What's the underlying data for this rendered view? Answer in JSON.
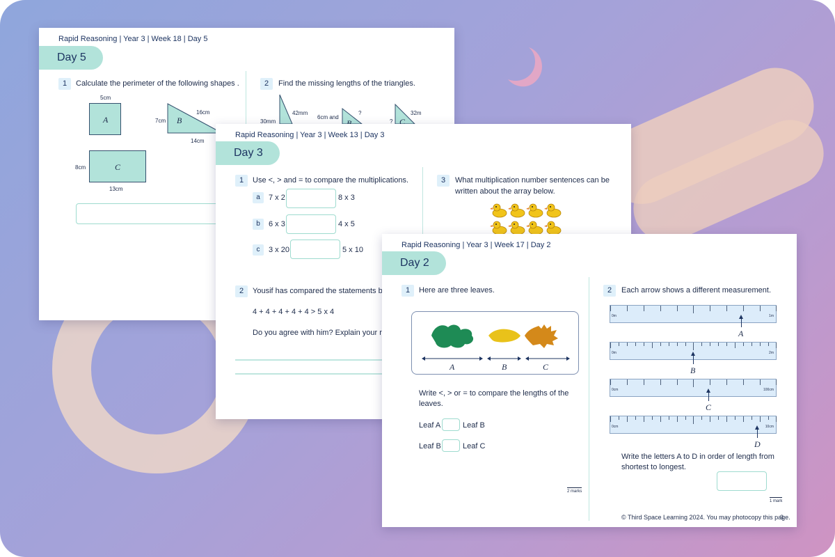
{
  "colors": {
    "teal": "#b2e3da",
    "navy": "#1d3461",
    "duck": "#f1c41a"
  },
  "sheet_week18": {
    "header": "Rapid Reasoning | Year 3 | Week 18 | Day 5",
    "day": "Day 5",
    "q1": {
      "num": "1",
      "text": "Calculate the perimeter of the following shapes .",
      "shape_a": {
        "letter": "A",
        "top": "5cm"
      },
      "shape_b": {
        "letter": "B",
        "left": "7cm",
        "hyp": "16cm",
        "bottom": "14cm"
      },
      "shape_c": {
        "letter": "C",
        "left": "8cm",
        "bottom": "13cm"
      }
    },
    "q2": {
      "num": "2",
      "text": "Find the missing lengths of the triangles.",
      "labels": [
        "30mm",
        "42mm",
        "6cm and",
        "?",
        "B",
        "?",
        "C",
        "32m"
      ]
    }
  },
  "sheet_week13": {
    "header": "Rapid Reasoning | Year 3 | Week 13 | Day 3",
    "day": "Day 3",
    "q1": {
      "num": "1",
      "text": "Use <, > and = to compare the multiplications.",
      "rows": [
        {
          "letter": "a",
          "left": "7 x 2",
          "right": "8 x 3"
        },
        {
          "letter": "b",
          "left": "6 x 3",
          "right": "4 x 5"
        },
        {
          "letter": "c",
          "left": "3 x 20",
          "right": "5 x 10"
        }
      ]
    },
    "q2": {
      "num": "2",
      "text": "Yousif has compared the statements below",
      "statement": "4 + 4 + 4 + 4 + 4  > 5 x 4",
      "question": "Do you agree with him? Explain your reaso"
    },
    "q3": {
      "num": "3",
      "text_line1": "What multiplication number sentences can be",
      "text_line2": "written about the array below."
    }
  },
  "sheet_week17": {
    "header": "Rapid Reasoning | Year 3 | Week 17 | Day 2",
    "day": "Day 2",
    "q1": {
      "num": "1",
      "text": "Here are three leaves.",
      "leaves": [
        "A",
        "B",
        "C"
      ],
      "prompt_line1": "Write <, > or = to compare the lengths of the",
      "prompt_line2": "leaves.",
      "comparisons": [
        {
          "left": "Leaf A",
          "right": "Leaf B"
        },
        {
          "left": "Leaf B",
          "right": "Leaf C"
        }
      ],
      "marks": "2 marks"
    },
    "q2": {
      "num": "2",
      "text": "Each arrow shows a different measurement.",
      "rulers": [
        {
          "start": "0m",
          "end": "1m",
          "letter": "A"
        },
        {
          "start": "0m",
          "end": "2m",
          "letter": "B"
        },
        {
          "start": "0cm",
          "end": "100cm",
          "letter": "C"
        },
        {
          "start": "0cm",
          "end": "10cm",
          "letter": "D"
        }
      ],
      "prompt_line1": "Write the letters A to D in order of length from",
      "prompt_line2": "shortest to longest.",
      "marks": "1 mark"
    },
    "footer": "© Third Space Learning 2024. You may photocopy this page.",
    "page_number": "3"
  }
}
